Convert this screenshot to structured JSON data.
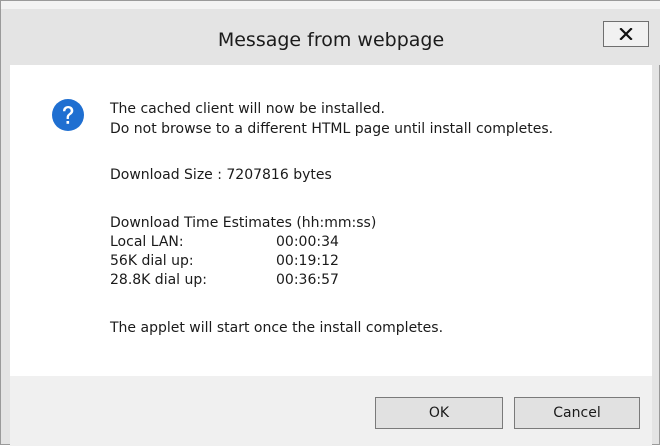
{
  "window": {
    "title": "Message from webpage",
    "close_label": "x"
  },
  "message": {
    "icon": "question-icon",
    "icon_color": "#1f6fd1",
    "line1": "The cached client will now be installed.",
    "line2": "Do not browse to a different HTML page until install completes.",
    "download_size": "Download Size : 7207816 bytes",
    "estimates_heading": "Download Time Estimates (hh:mm:ss)",
    "estimates": [
      {
        "label": "Local LAN:",
        "time": "00:00:34"
      },
      {
        "label": "56K dial up:",
        "time": "00:19:12"
      },
      {
        "label": "28.8K dial up:",
        "time": "00:36:57"
      }
    ],
    "footer_note": "The applet will start once the install completes."
  },
  "buttons": {
    "ok": "OK",
    "cancel": "Cancel"
  }
}
